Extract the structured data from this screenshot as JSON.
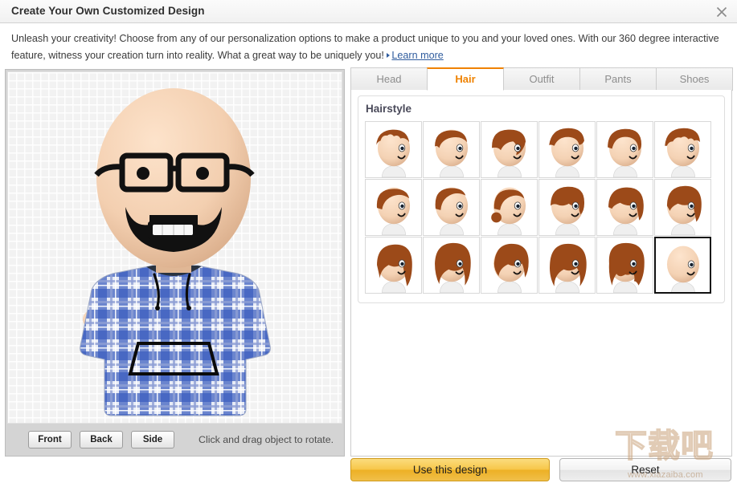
{
  "window": {
    "title": "Create Your Own Customized Design",
    "close_icon": "close-icon"
  },
  "intro": {
    "text": "Unleash your creativity! Choose from any of our personalization options to make a product unique to you and your loved ones. With our 360 degree interactive feature, witness your creation turn into reality. What a great way to be uniquely you!",
    "link_label": "Learn more"
  },
  "preview": {
    "view_buttons": [
      {
        "label": "Front"
      },
      {
        "label": "Back"
      },
      {
        "label": "Side"
      }
    ],
    "hint": "Click and drag object to rotate.",
    "avatar": {
      "hair": "bald",
      "skin_color": "#f3d3b5",
      "glasses_color": "#111111",
      "beard_color": "#111111",
      "shirt": "blue-plaid-hoodie",
      "shirt_color": "#2f52b5",
      "pants_color": "#1472a8",
      "shoes_color": "#1d2338"
    }
  },
  "tabs": [
    {
      "label": "Head",
      "active": false
    },
    {
      "label": "Hair",
      "active": true
    },
    {
      "label": "Outfit",
      "active": false
    },
    {
      "label": "Pants",
      "active": false
    },
    {
      "label": "Shoes",
      "active": false
    }
  ],
  "hairstyle": {
    "section_title": "Hairstyle",
    "hair_color": "#9c4a19",
    "selected_index": 17,
    "options": [
      {
        "name": "spiky-short",
        "type": "spiky",
        "selected": false
      },
      {
        "name": "receding-short",
        "type": "receding",
        "selected": false
      },
      {
        "name": "side-swept",
        "type": "sideswept",
        "selected": false
      },
      {
        "name": "combed-over",
        "type": "combed",
        "selected": false
      },
      {
        "name": "rounded-short",
        "type": "rounded",
        "selected": false
      },
      {
        "name": "textured-crop",
        "type": "textured",
        "selected": false
      },
      {
        "name": "thinning-top",
        "type": "thinning",
        "selected": false
      },
      {
        "name": "balding-sides",
        "type": "balding",
        "selected": false
      },
      {
        "name": "small-bun",
        "type": "bun",
        "selected": false
      },
      {
        "name": "short-bob",
        "type": "shortbob",
        "selected": false
      },
      {
        "name": "bowl-bob",
        "type": "bowlbob",
        "selected": false
      },
      {
        "name": "straight-bob",
        "type": "straightbob",
        "selected": false
      },
      {
        "name": "long-straight",
        "type": "longstraight",
        "selected": false
      },
      {
        "name": "long-wavy",
        "type": "longwavy",
        "selected": false
      },
      {
        "name": "medium-wavy",
        "type": "mediumwavy",
        "selected": false
      },
      {
        "name": "shoulder-wavy",
        "type": "shoulderwavy",
        "selected": false
      },
      {
        "name": "curly-long",
        "type": "curlylong",
        "selected": false
      },
      {
        "name": "bald",
        "type": "bald",
        "selected": true
      }
    ]
  },
  "footer": {
    "primary_label": "Use this design",
    "secondary_label": "Reset"
  },
  "watermark": {
    "cn": "下载吧",
    "url": "www.xiazaiba.com"
  }
}
